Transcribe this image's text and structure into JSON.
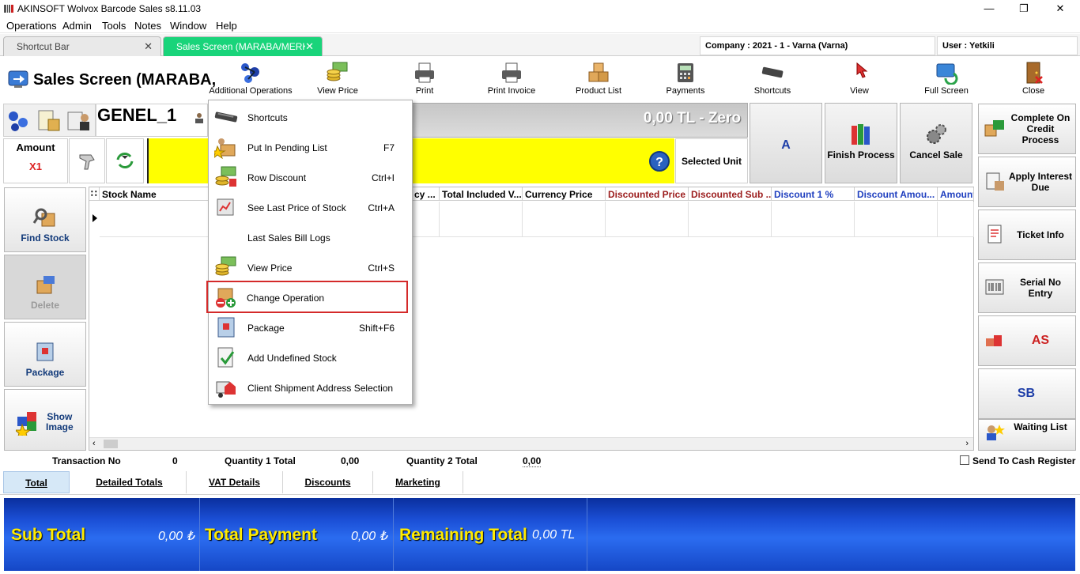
{
  "window": {
    "title": "AKINSOFT Wolvox Barcode Sales s8.11.03",
    "minimize": "—",
    "restore": "❐",
    "close": "✕"
  },
  "menubar": [
    "Operations",
    "Admin",
    "Tools",
    "Notes",
    "Window",
    "Help"
  ],
  "tabs": [
    {
      "label": "Shortcut Bar",
      "active": false
    },
    {
      "label": "Sales Screen (MARABA/MERK",
      "active": true
    }
  ],
  "company": "Company : 2021 - 1 - Varna (Varna)",
  "user": "User : Yetkili",
  "screen_title": "Sales Screen (MARABA,",
  "toolbar": [
    {
      "label": "Additional Operations",
      "icon": "molecule-icon"
    },
    {
      "label": "View Price",
      "icon": "coins-icon"
    },
    {
      "label": "Print",
      "icon": "printer-icon"
    },
    {
      "label": "Print Invoice",
      "icon": "printer-icon"
    },
    {
      "label": "Product List",
      "icon": "boxes-icon"
    },
    {
      "label": "Payments",
      "icon": "calculator-icon"
    },
    {
      "label": "Shortcuts",
      "icon": "keyboard-icon"
    },
    {
      "label": "View",
      "icon": "cursor-icon"
    },
    {
      "label": "Full Screen",
      "icon": "monitor-icon"
    },
    {
      "label": "Close",
      "icon": "door-icon"
    }
  ],
  "customer_code": "GENEL_1",
  "total_display": "0,00 TL - Zero",
  "amount": {
    "label": "Amount",
    "value": "X1"
  },
  "selected_unit": "Selected Unit",
  "price_level": "A",
  "finish_process": "Finish Process",
  "cancel_sale": "Cancel Sale",
  "left_buttons": [
    {
      "label": "Find Stock",
      "disabled": false
    },
    {
      "label": "Delete",
      "disabled": true
    },
    {
      "label": "Package",
      "disabled": false
    },
    {
      "label": "Show\nImage",
      "disabled": false
    }
  ],
  "grid_columns": [
    {
      "label": "Stock Name",
      "color": "#000000"
    },
    {
      "label": "cy ...",
      "color": "#000000"
    },
    {
      "label": "Total Included V...",
      "color": "#000000"
    },
    {
      "label": "Currency Price",
      "color": "#000000"
    },
    {
      "label": "Discounted Price",
      "color": "#9b1c1c"
    },
    {
      "label": "Discounted Sub ...",
      "color": "#9b1c1c"
    },
    {
      "label": "Discount 1 %",
      "color": "#1f3fbf"
    },
    {
      "label": "Discount Amou...",
      "color": "#1f3fbf"
    },
    {
      "label": "Amount",
      "color": "#1f3fbf"
    }
  ],
  "right_buttons": [
    {
      "label": "Complete On Credit Process"
    },
    {
      "label": "Apply Interest Due"
    },
    {
      "label": "Ticket Info"
    },
    {
      "label": "Serial No Entry"
    },
    {
      "label": "AS"
    },
    {
      "label": "SB"
    },
    {
      "label": "Waiting List"
    }
  ],
  "qty_strip": {
    "transaction_no_label": "Transaction No",
    "transaction_no": "0",
    "qty1_label": "Quantity 1 Total",
    "qty1": "0,00",
    "qty2_label": "Quantity 2 Total",
    "qty2": "0,00",
    "send_to_cash": "Send To Cash Register"
  },
  "bottom_tabs": [
    "Total",
    "Detailed Totals",
    "VAT Details",
    "Discounts",
    "Marketing"
  ],
  "totals": {
    "sub_total_label": "Sub Total",
    "sub_total": "0,00 ₺",
    "total_payment_label": "Total Payment",
    "total_payment": "0,00 ₺",
    "remaining_label": "Remaining Total",
    "remaining": "0,00 TL"
  },
  "dropdown": [
    {
      "label": "Shortcuts",
      "shortcut": "",
      "icon": "keyboard-icon"
    },
    {
      "label": "Put In Pending List",
      "shortcut": "F7",
      "icon": "pending-list-icon"
    },
    {
      "label": "Row Discount",
      "shortcut": "Ctrl+I",
      "icon": "discount-icon"
    },
    {
      "label": "See Last Price of Stock",
      "shortcut": "Ctrl+A",
      "icon": "price-history-icon"
    },
    {
      "label": "Last Sales Bill Logs",
      "shortcut": "",
      "icon": ""
    },
    {
      "label": "View Price",
      "shortcut": "Ctrl+S",
      "icon": "coins-icon"
    },
    {
      "label": "Change Operation",
      "shortcut": "",
      "icon": "change-operation-icon",
      "highlighted": true
    },
    {
      "label": "Package",
      "shortcut": "Shift+F6",
      "icon": "package-icon"
    },
    {
      "label": "Add Undefined Stock",
      "shortcut": "",
      "icon": "add-stock-icon"
    },
    {
      "label": "Client Shipment Address Selection",
      "shortcut": "",
      "icon": "shipment-icon"
    }
  ]
}
